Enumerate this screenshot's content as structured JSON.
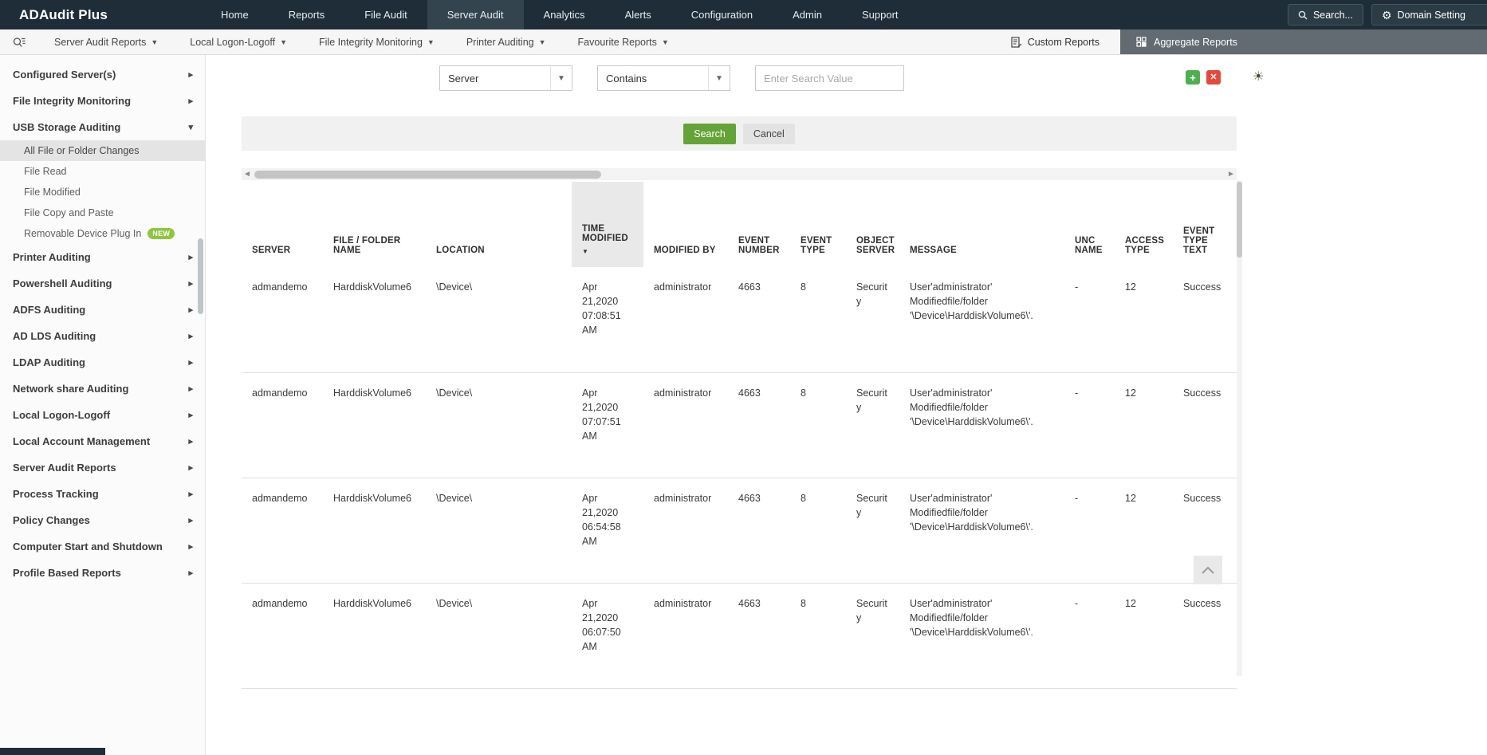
{
  "topnav": {
    "logo": "ADAudit Plus",
    "items": [
      {
        "label": "Home"
      },
      {
        "label": "Reports"
      },
      {
        "label": "File Audit"
      },
      {
        "label": "Server Audit",
        "active": true
      },
      {
        "label": "Analytics"
      },
      {
        "label": "Alerts"
      },
      {
        "label": "Configuration"
      },
      {
        "label": "Admin"
      },
      {
        "label": "Support"
      }
    ],
    "search_label": "Search...",
    "domain_setting_label": "Domain Setting"
  },
  "subnav": {
    "items": [
      "Server Audit Reports",
      "Local Logon-Logoff",
      "File Integrity Monitoring",
      "Printer Auditing",
      "Favourite Reports"
    ],
    "custom_reports": "Custom Reports",
    "aggregate_reports": "Aggregate Reports"
  },
  "sidebar": {
    "items": [
      {
        "label": "Configured Server(s)"
      },
      {
        "label": "File Integrity Monitoring"
      },
      {
        "label": "USB Storage Auditing",
        "expanded": true,
        "children": [
          {
            "label": "All File or Folder Changes",
            "selected": true
          },
          {
            "label": "File Read"
          },
          {
            "label": "File Modified"
          },
          {
            "label": "File Copy and Paste"
          },
          {
            "label": "Removable Device Plug In",
            "badge": "NEW"
          }
        ]
      },
      {
        "label": "Printer Auditing"
      },
      {
        "label": "Powershell Auditing"
      },
      {
        "label": "ADFS Auditing"
      },
      {
        "label": "AD LDS Auditing"
      },
      {
        "label": "LDAP Auditing"
      },
      {
        "label": "Network share Auditing"
      },
      {
        "label": "Local Logon-Logoff"
      },
      {
        "label": "Local Account Management"
      },
      {
        "label": "Server Audit Reports"
      },
      {
        "label": "Process Tracking"
      },
      {
        "label": "Policy Changes"
      },
      {
        "label": "Computer Start and Shutdown"
      },
      {
        "label": "Profile Based Reports"
      }
    ]
  },
  "filter": {
    "field_value": "Server",
    "operator_value": "Contains",
    "search_placeholder": "Enter Search Value",
    "search_button": "Search",
    "cancel_button": "Cancel"
  },
  "table": {
    "columns": [
      "SERVER",
      "FILE / FOLDER NAME",
      "LOCATION",
      "TIME MODIFIED",
      "MODIFIED BY",
      "EVENT NUMBER",
      "EVENT TYPE",
      "OBJECT SERVER",
      "MESSAGE",
      "UNC NAME",
      "ACCESS TYPE",
      "EVENT TYPE TEXT"
    ],
    "rows": [
      {
        "server": "admandemo",
        "file": "HarddiskVolume6",
        "location": "\\Device\\",
        "time": "Apr 21,2020 07:08:51 AM",
        "modified_by": "administrator",
        "event_number": "4663",
        "event_type": "8",
        "object_server": "Security",
        "message": "User'administrator' Modifiedfile/folder '\\Device\\HarddiskVolume6\\'.",
        "unc": "-",
        "access_type": "12",
        "event_type_text": "Success"
      },
      {
        "server": "admandemo",
        "file": "HarddiskVolume6",
        "location": "\\Device\\",
        "time": "Apr 21,2020 07:07:51 AM",
        "modified_by": "administrator",
        "event_number": "4663",
        "event_type": "8",
        "object_server": "Security",
        "message": "User'administrator' Modifiedfile/folder '\\Device\\HarddiskVolume6\\'.",
        "unc": "-",
        "access_type": "12",
        "event_type_text": "Success"
      },
      {
        "server": "admandemo",
        "file": "HarddiskVolume6",
        "location": "\\Device\\",
        "time": "Apr 21,2020 06:54:58 AM",
        "modified_by": "administrator",
        "event_number": "4663",
        "event_type": "8",
        "object_server": "Security",
        "message": "User'administrator' Modifiedfile/folder '\\Device\\HarddiskVolume6\\'.",
        "unc": "-",
        "access_type": "12",
        "event_type_text": "Success"
      },
      {
        "server": "admandemo",
        "file": "HarddiskVolume6",
        "location": "\\Device\\",
        "time": "Apr 21,2020 06:07:50 AM",
        "modified_by": "administrator",
        "event_number": "4663",
        "event_type": "8",
        "object_server": "Security",
        "message": "User'administrator' Modifiedfile/folder '\\Device\\HarddiskVolume6\\'.",
        "unc": "-",
        "access_type": "12",
        "event_type_text": "Success"
      }
    ]
  }
}
